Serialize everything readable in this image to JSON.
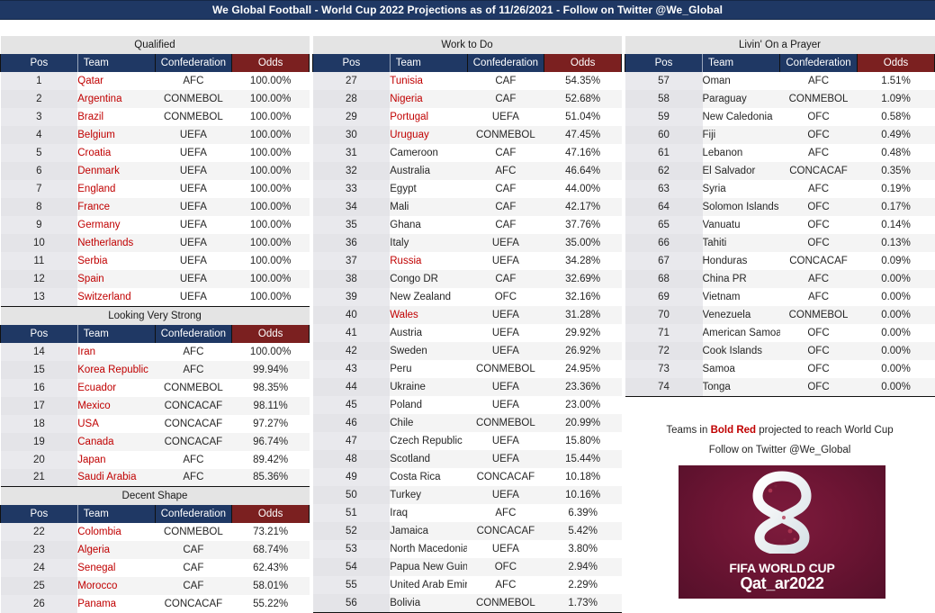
{
  "title": "We Global Football - World Cup 2022 Projections as of 11/26/2021 - Follow on Twitter @We_Global",
  "columns_headers": {
    "pos": "Pos",
    "team": "Team",
    "confederation": "Confederation",
    "odds": "Odds"
  },
  "colors": {
    "header_blue": "#1F3864",
    "odds_red": "#7B2020",
    "qualified_text_red": "#C00000",
    "band_gray": "#E4E4E4",
    "logo_maroon": "#6E1534"
  },
  "sections": {
    "qualified": {
      "title": "Qualified"
    },
    "looking_very_strong": {
      "title": "Looking Very Strong"
    },
    "decent_shape": {
      "title": "Decent Shape"
    },
    "work_to_do": {
      "title": "Work to Do"
    },
    "livin_on_a_prayer": {
      "title": "Livin' On a Prayer"
    }
  },
  "rows": {
    "qualified": [
      {
        "pos": "1",
        "team": "Qatar",
        "conf": "AFC",
        "odds": "100.00%",
        "proj": true
      },
      {
        "pos": "2",
        "team": "Argentina",
        "conf": "CONMEBOL",
        "odds": "100.00%",
        "proj": true
      },
      {
        "pos": "3",
        "team": "Brazil",
        "conf": "CONMEBOL",
        "odds": "100.00%",
        "proj": true
      },
      {
        "pos": "4",
        "team": "Belgium",
        "conf": "UEFA",
        "odds": "100.00%",
        "proj": true
      },
      {
        "pos": "5",
        "team": "Croatia",
        "conf": "UEFA",
        "odds": "100.00%",
        "proj": true
      },
      {
        "pos": "6",
        "team": "Denmark",
        "conf": "UEFA",
        "odds": "100.00%",
        "proj": true
      },
      {
        "pos": "7",
        "team": "England",
        "conf": "UEFA",
        "odds": "100.00%",
        "proj": true
      },
      {
        "pos": "8",
        "team": "France",
        "conf": "UEFA",
        "odds": "100.00%",
        "proj": true
      },
      {
        "pos": "9",
        "team": "Germany",
        "conf": "UEFA",
        "odds": "100.00%",
        "proj": true
      },
      {
        "pos": "10",
        "team": "Netherlands",
        "conf": "UEFA",
        "odds": "100.00%",
        "proj": true
      },
      {
        "pos": "11",
        "team": "Serbia",
        "conf": "UEFA",
        "odds": "100.00%",
        "proj": true
      },
      {
        "pos": "12",
        "team": "Spain",
        "conf": "UEFA",
        "odds": "100.00%",
        "proj": true
      },
      {
        "pos": "13",
        "team": "Switzerland",
        "conf": "UEFA",
        "odds": "100.00%",
        "proj": true
      }
    ],
    "looking_very_strong": [
      {
        "pos": "14",
        "team": "Iran",
        "conf": "AFC",
        "odds": "100.00%",
        "proj": true
      },
      {
        "pos": "15",
        "team": "Korea Republic",
        "conf": "AFC",
        "odds": "99.94%",
        "proj": true
      },
      {
        "pos": "16",
        "team": "Ecuador",
        "conf": "CONMEBOL",
        "odds": "98.35%",
        "proj": true
      },
      {
        "pos": "17",
        "team": "Mexico",
        "conf": "CONCACAF",
        "odds": "98.11%",
        "proj": true
      },
      {
        "pos": "18",
        "team": "USA",
        "conf": "CONCACAF",
        "odds": "97.27%",
        "proj": true
      },
      {
        "pos": "19",
        "team": "Canada",
        "conf": "CONCACAF",
        "odds": "96.74%",
        "proj": true
      },
      {
        "pos": "20",
        "team": "Japan",
        "conf": "AFC",
        "odds": "89.42%",
        "proj": true
      },
      {
        "pos": "21",
        "team": "Saudi Arabia",
        "conf": "AFC",
        "odds": "85.36%",
        "proj": true
      }
    ],
    "decent_shape": [
      {
        "pos": "22",
        "team": "Colombia",
        "conf": "CONMEBOL",
        "odds": "73.21%",
        "proj": true
      },
      {
        "pos": "23",
        "team": "Algeria",
        "conf": "CAF",
        "odds": "68.74%",
        "proj": true
      },
      {
        "pos": "24",
        "team": "Senegal",
        "conf": "CAF",
        "odds": "62.43%",
        "proj": true
      },
      {
        "pos": "25",
        "team": "Morocco",
        "conf": "CAF",
        "odds": "58.01%",
        "proj": true
      },
      {
        "pos": "26",
        "team": "Panama",
        "conf": "CONCACAF",
        "odds": "55.22%",
        "proj": true
      }
    ],
    "work_to_do": [
      {
        "pos": "27",
        "team": "Tunisia",
        "conf": "CAF",
        "odds": "54.35%",
        "proj": true
      },
      {
        "pos": "28",
        "team": "Nigeria",
        "conf": "CAF",
        "odds": "52.68%",
        "proj": true
      },
      {
        "pos": "29",
        "team": "Portugal",
        "conf": "UEFA",
        "odds": "51.04%",
        "proj": true
      },
      {
        "pos": "30",
        "team": "Uruguay",
        "conf": "CONMEBOL",
        "odds": "47.45%",
        "proj": true
      },
      {
        "pos": "31",
        "team": "Cameroon",
        "conf": "CAF",
        "odds": "47.16%",
        "proj": false
      },
      {
        "pos": "32",
        "team": "Australia",
        "conf": "AFC",
        "odds": "46.64%",
        "proj": false
      },
      {
        "pos": "33",
        "team": "Egypt",
        "conf": "CAF",
        "odds": "44.00%",
        "proj": false
      },
      {
        "pos": "34",
        "team": "Mali",
        "conf": "CAF",
        "odds": "42.17%",
        "proj": false
      },
      {
        "pos": "35",
        "team": "Ghana",
        "conf": "CAF",
        "odds": "37.76%",
        "proj": false
      },
      {
        "pos": "36",
        "team": "Italy",
        "conf": "UEFA",
        "odds": "35.00%",
        "proj": false
      },
      {
        "pos": "37",
        "team": "Russia",
        "conf": "UEFA",
        "odds": "34.28%",
        "proj": true
      },
      {
        "pos": "38",
        "team": "Congo DR",
        "conf": "CAF",
        "odds": "32.69%",
        "proj": false
      },
      {
        "pos": "39",
        "team": "New Zealand",
        "conf": "OFC",
        "odds": "32.16%",
        "proj": false
      },
      {
        "pos": "40",
        "team": "Wales",
        "conf": "UEFA",
        "odds": "31.28%",
        "proj": true
      },
      {
        "pos": "41",
        "team": "Austria",
        "conf": "UEFA",
        "odds": "29.92%",
        "proj": false
      },
      {
        "pos": "42",
        "team": "Sweden",
        "conf": "UEFA",
        "odds": "26.92%",
        "proj": false
      },
      {
        "pos": "43",
        "team": "Peru",
        "conf": "CONMEBOL",
        "odds": "24.95%",
        "proj": false
      },
      {
        "pos": "44",
        "team": "Ukraine",
        "conf": "UEFA",
        "odds": "23.36%",
        "proj": false
      },
      {
        "pos": "45",
        "team": "Poland",
        "conf": "UEFA",
        "odds": "23.00%",
        "proj": false
      },
      {
        "pos": "46",
        "team": "Chile",
        "conf": "CONMEBOL",
        "odds": "20.99%",
        "proj": false
      },
      {
        "pos": "47",
        "team": "Czech Republic",
        "conf": "UEFA",
        "odds": "15.80%",
        "proj": false
      },
      {
        "pos": "48",
        "team": "Scotland",
        "conf": "UEFA",
        "odds": "15.44%",
        "proj": false
      },
      {
        "pos": "49",
        "team": "Costa Rica",
        "conf": "CONCACAF",
        "odds": "10.18%",
        "proj": false
      },
      {
        "pos": "50",
        "team": "Turkey",
        "conf": "UEFA",
        "odds": "10.16%",
        "proj": false
      },
      {
        "pos": "51",
        "team": "Iraq",
        "conf": "AFC",
        "odds": "6.39%",
        "proj": false
      },
      {
        "pos": "52",
        "team": "Jamaica",
        "conf": "CONCACAF",
        "odds": "5.42%",
        "proj": false
      },
      {
        "pos": "53",
        "team": "North Macedonia",
        "conf": "UEFA",
        "odds": "3.80%",
        "proj": false
      },
      {
        "pos": "54",
        "team": "Papua New Guinea",
        "conf": "OFC",
        "odds": "2.94%",
        "proj": false
      },
      {
        "pos": "55",
        "team": "United Arab Emirates",
        "conf": "AFC",
        "odds": "2.29%",
        "proj": false
      },
      {
        "pos": "56",
        "team": "Bolivia",
        "conf": "CONMEBOL",
        "odds": "1.73%",
        "proj": false
      }
    ],
    "livin_on_a_prayer": [
      {
        "pos": "57",
        "team": "Oman",
        "conf": "AFC",
        "odds": "1.51%",
        "proj": false
      },
      {
        "pos": "58",
        "team": "Paraguay",
        "conf": "CONMEBOL",
        "odds": "1.09%",
        "proj": false
      },
      {
        "pos": "59",
        "team": "New Caledonia",
        "conf": "OFC",
        "odds": "0.58%",
        "proj": false
      },
      {
        "pos": "60",
        "team": "Fiji",
        "conf": "OFC",
        "odds": "0.49%",
        "proj": false
      },
      {
        "pos": "61",
        "team": "Lebanon",
        "conf": "AFC",
        "odds": "0.48%",
        "proj": false
      },
      {
        "pos": "62",
        "team": "El Salvador",
        "conf": "CONCACAF",
        "odds": "0.35%",
        "proj": false
      },
      {
        "pos": "63",
        "team": "Syria",
        "conf": "AFC",
        "odds": "0.19%",
        "proj": false
      },
      {
        "pos": "64",
        "team": "Solomon Islands",
        "conf": "OFC",
        "odds": "0.17%",
        "proj": false
      },
      {
        "pos": "65",
        "team": "Vanuatu",
        "conf": "OFC",
        "odds": "0.14%",
        "proj": false
      },
      {
        "pos": "66",
        "team": "Tahiti",
        "conf": "OFC",
        "odds": "0.13%",
        "proj": false
      },
      {
        "pos": "67",
        "team": "Honduras",
        "conf": "CONCACAF",
        "odds": "0.09%",
        "proj": false
      },
      {
        "pos": "68",
        "team": "China PR",
        "conf": "AFC",
        "odds": "0.00%",
        "proj": false
      },
      {
        "pos": "69",
        "team": "Vietnam",
        "conf": "AFC",
        "odds": "0.00%",
        "proj": false
      },
      {
        "pos": "70",
        "team": "Venezuela",
        "conf": "CONMEBOL",
        "odds": "0.00%",
        "proj": false
      },
      {
        "pos": "71",
        "team": "American Samoa",
        "conf": "OFC",
        "odds": "0.00%",
        "proj": false
      },
      {
        "pos": "72",
        "team": "Cook Islands",
        "conf": "OFC",
        "odds": "0.00%",
        "proj": false
      },
      {
        "pos": "73",
        "team": "Samoa",
        "conf": "OFC",
        "odds": "0.00%",
        "proj": false
      },
      {
        "pos": "74",
        "team": "Tonga",
        "conf": "OFC",
        "odds": "0.00%",
        "proj": false
      }
    ]
  },
  "note": {
    "line1_prefix": "Teams in ",
    "line1_highlight": "Bold Red",
    "line1_suffix": " projected to reach World Cup",
    "line2": "Follow on Twitter @We_Global"
  },
  "logo": {
    "fifa_text": "FIFA WORLD CUP",
    "qatar_text": "Qat_ar2022"
  }
}
